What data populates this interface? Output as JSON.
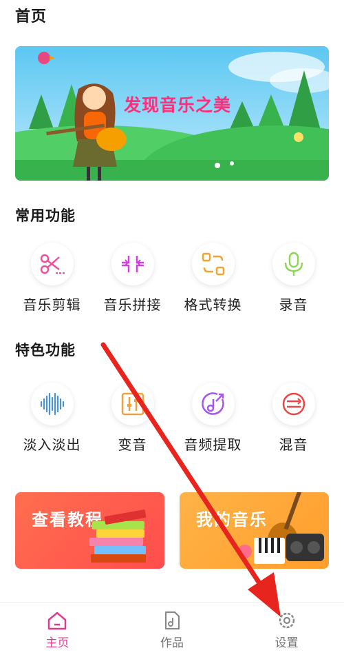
{
  "header": {
    "title": "首页"
  },
  "banner": {
    "text": "发现音乐之美"
  },
  "common": {
    "title": "常用功能",
    "items": [
      {
        "label": "音乐剪辑",
        "icon": "scissors-icon"
      },
      {
        "label": "音乐拼接",
        "icon": "merge-icon"
      },
      {
        "label": "格式转换",
        "icon": "convert-icon"
      },
      {
        "label": "录音",
        "icon": "microphone-icon"
      }
    ]
  },
  "special": {
    "title": "特色功能",
    "items": [
      {
        "label": "淡入淡出",
        "icon": "waveform-icon"
      },
      {
        "label": "变音",
        "icon": "equalizer-icon"
      },
      {
        "label": "音频提取",
        "icon": "music-note-icon"
      },
      {
        "label": "混音",
        "icon": "mix-icon"
      }
    ]
  },
  "cards": {
    "tutorial": {
      "label": "查看教程"
    },
    "my_music": {
      "label": "我的音乐"
    }
  },
  "tabbar": {
    "items": [
      {
        "label": "主页",
        "icon": "home-icon",
        "active": true
      },
      {
        "label": "作品",
        "icon": "document-icon",
        "active": false
      },
      {
        "label": "设置",
        "icon": "gear-icon",
        "active": false
      }
    ]
  },
  "colors": {
    "accent": "#e03a8b",
    "banner_text": "#ff2d7a",
    "scissors": "#f0509b",
    "merge": "#d33ee0",
    "convert": "#f0a530",
    "microphone": "#8fd657",
    "waveform": "#4a90e2",
    "equalizer": "#f2a13a",
    "music_note": "#a855f7",
    "mix": "#ef4444",
    "arrow": "#e8241f"
  }
}
